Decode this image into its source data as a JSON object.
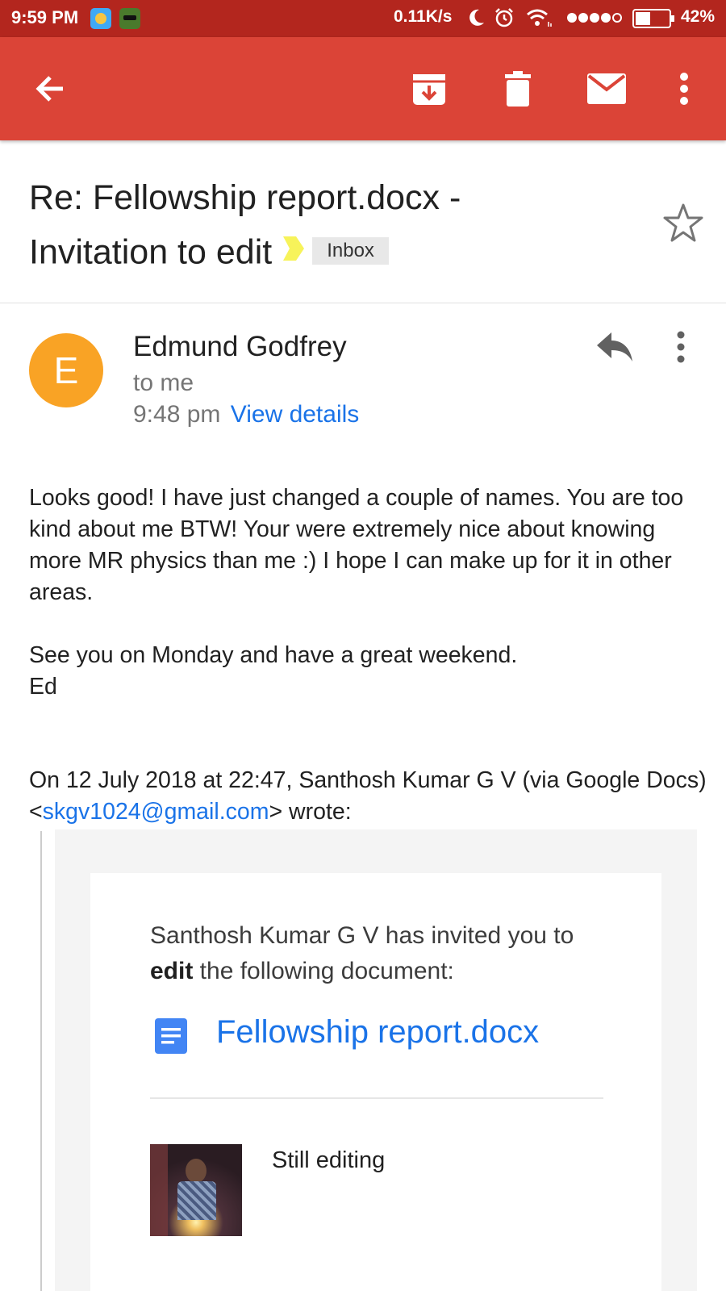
{
  "status_bar": {
    "time": "9:59 PM",
    "net_speed": "0.11K/s",
    "battery": "42%"
  },
  "app_bar": {
    "back_icon": "arrow-back-icon",
    "archive_icon": "archive-icon",
    "delete_icon": "trash-icon",
    "mark_unread_icon": "mail-icon",
    "more_icon": "more-vert-icon",
    "color": "#db4437"
  },
  "subject": {
    "line1": "Re: Fellowship report.docx -",
    "line2": "Invitation to edit",
    "label": "Inbox",
    "importance_marker_color": "#f7f35a"
  },
  "sender": {
    "avatar_letter": "E",
    "avatar_color": "#f9a325",
    "name": "Edmund Godfrey",
    "recipient": "to me",
    "time": "9:48 pm",
    "view_details": "View details"
  },
  "body": {
    "paragraph1": "Looks good! I have just changed a couple of names. You are too kind about me BTW! Your were extremely nice about knowing more MR physics than me :) I hope I can make up for it in other areas.",
    "paragraph2": "See you on Monday and have a great weekend.",
    "signature": "Ed",
    "quote_intro_before": "On 12 July 2018 at 22:47, Santhosh Kumar G V (via Google Docs) <",
    "quote_email": "skgv1024@gmail.com",
    "quote_intro_after": "> wrote:"
  },
  "quoted_card": {
    "invite_before": "Santhosh Kumar G V has invited you to ",
    "invite_bold": "edit",
    "invite_after": " the following document:",
    "doc_icon": "google-docs-icon",
    "doc_name": "Fellowship report.docx",
    "comment": "Still editing"
  }
}
